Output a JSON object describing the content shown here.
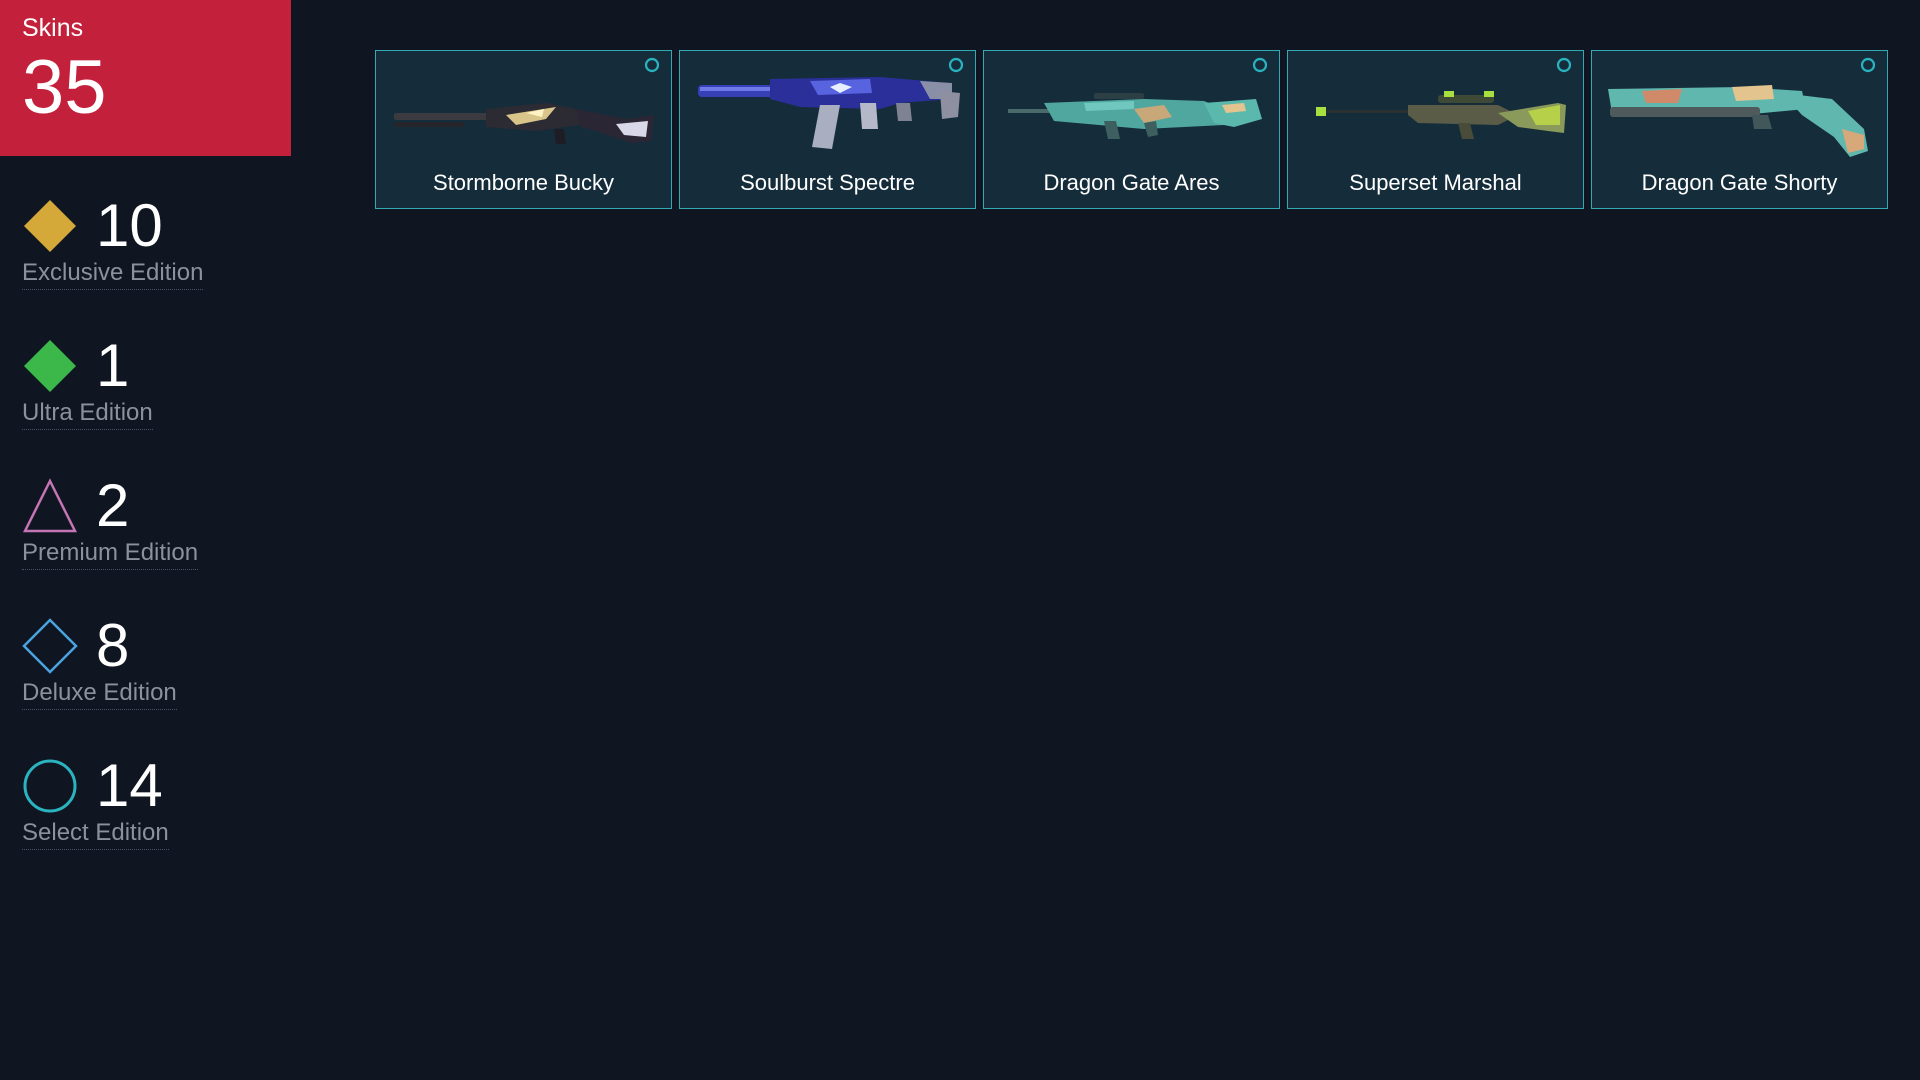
{
  "summary": {
    "label": "Skins",
    "total": "35",
    "accent_color": "#c3213b"
  },
  "editions": [
    {
      "count": "10",
      "name": "Exclusive Edition",
      "icon": "gold-diamond-icon",
      "color": "#d4a93a"
    },
    {
      "count": "1",
      "name": "Ultra Edition",
      "icon": "green-diamond-icon",
      "color": "#3cb84b"
    },
    {
      "count": "2",
      "name": "Premium Edition",
      "icon": "pink-triangle-outline-icon",
      "color": "#c574b6"
    },
    {
      "count": "8",
      "name": "Deluxe Edition",
      "icon": "blue-diamond-outline-icon",
      "color": "#4aa3df"
    },
    {
      "count": "14",
      "name": "Select Edition",
      "icon": "teal-circle-outline-icon",
      "color": "#2bb4c0"
    }
  ],
  "skins": [
    {
      "name": "Stormborne Bucky",
      "badge": "select-edition-circle-icon",
      "image": "shotgun-dark-gold-skin-image"
    },
    {
      "name": "Soulburst Spectre",
      "badge": "select-edition-circle-icon",
      "image": "smg-blue-purple-skin-image"
    },
    {
      "name": "Dragon Gate Ares",
      "badge": "select-edition-circle-icon",
      "image": "machinegun-teal-gold-skin-image"
    },
    {
      "name": "Superset Marshal",
      "badge": "select-edition-circle-icon",
      "image": "sniper-green-skin-image"
    },
    {
      "name": "Dragon Gate Shorty",
      "badge": "select-edition-circle-icon",
      "image": "pistol-shotgun-teal-skin-image"
    }
  ],
  "colors": {
    "background": "#0f1622",
    "card_background": "#152d3b",
    "card_border": "#33a9b3",
    "muted_text": "#8b929c"
  }
}
